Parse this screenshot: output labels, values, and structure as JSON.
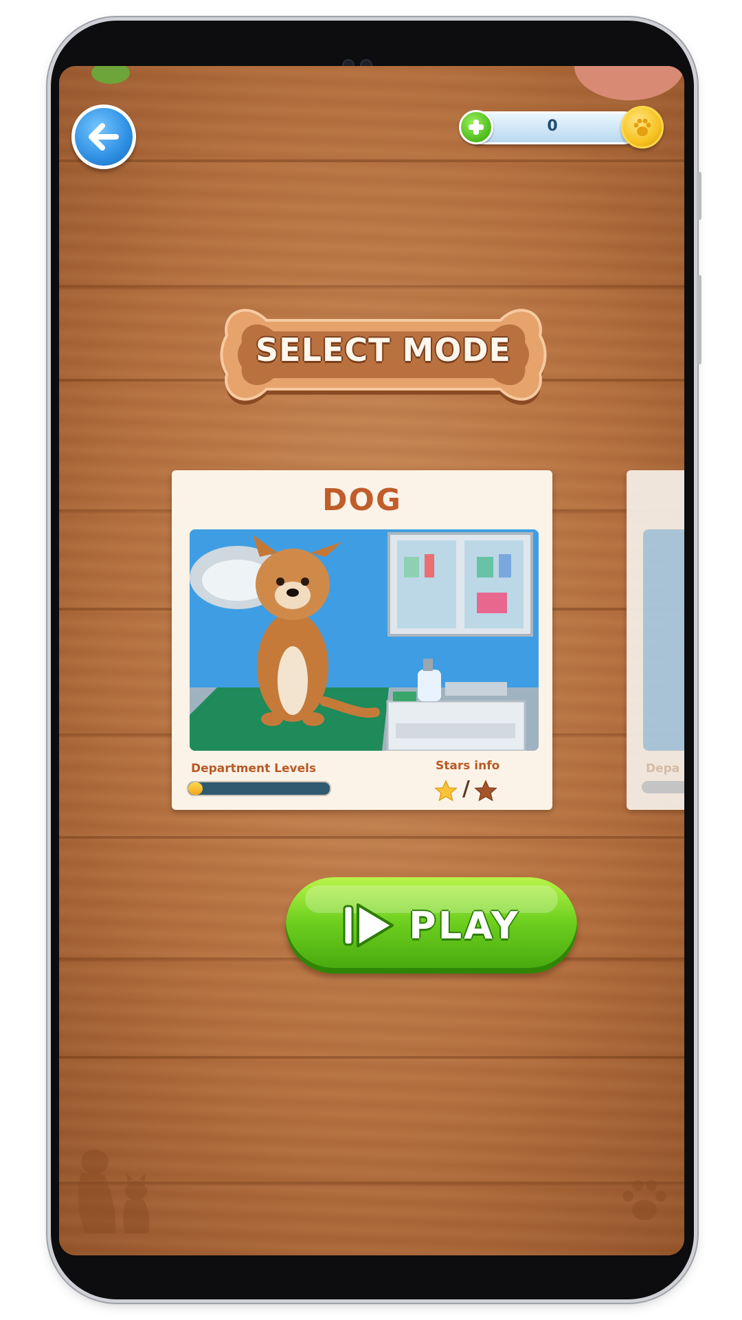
{
  "game": {
    "title": "SELECT MODE",
    "coins": "0"
  },
  "mode_card": {
    "title": "DOG",
    "department_label": "Department Levels",
    "department_progress": 0.1,
    "stars_label": "Stars info",
    "stars_separator": "/"
  },
  "next_card": {
    "department_label": "Depa"
  },
  "play_button": {
    "label": "PLAY"
  },
  "colors": {
    "wood": "#b4703f",
    "accent_orange": "#c05d2a",
    "play_green": "#6fd020",
    "back_blue": "#2e8fe3",
    "coin_gold": "#f7c222"
  },
  "icons": [
    "back-arrow-icon",
    "plus-icon",
    "paw-coin-icon",
    "star-filled-icon",
    "star-empty-icon",
    "play-icon",
    "paw-print-icon",
    "dog-cat-silhouette-icon"
  ]
}
